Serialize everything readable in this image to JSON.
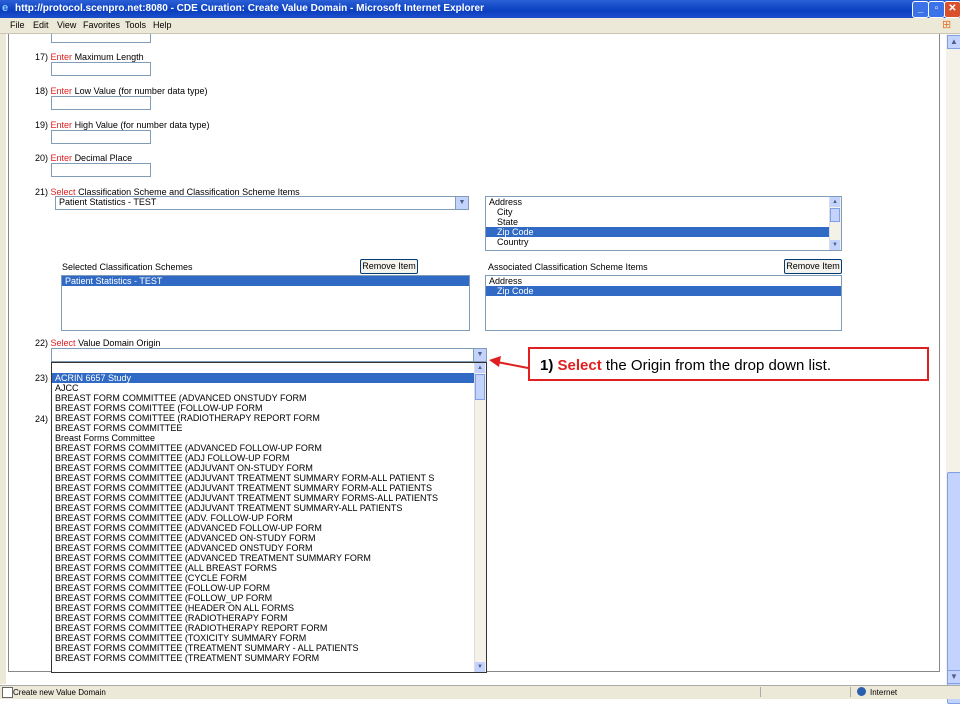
{
  "window": {
    "title": "http://protocol.scenpro.net:8080 - CDE Curation: Create Value Domain - Microsoft Internet Explorer",
    "menu": [
      "File",
      "Edit",
      "View",
      "Favorites",
      "Tools",
      "Help"
    ]
  },
  "form": {
    "enter_word": "Enter",
    "select_word": "Select",
    "item17": {
      "num": "17)",
      "text": "Maximum Length"
    },
    "item18": {
      "num": "18)",
      "text": "Low Value (for number data type)"
    },
    "item19": {
      "num": "19)",
      "text": "High Value (for number data type)"
    },
    "item20": {
      "num": "20)",
      "text": "Decimal Place"
    },
    "item21": {
      "num": "21)",
      "text": "Classification Scheme and Classification Scheme Items",
      "scheme_value": "Patient Statistics - TEST",
      "items_list": [
        {
          "label": "Address",
          "indent": false,
          "selected": false
        },
        {
          "label": "City",
          "indent": true,
          "selected": false
        },
        {
          "label": "State",
          "indent": true,
          "selected": false
        },
        {
          "label": "Zip Code",
          "indent": true,
          "selected": true
        },
        {
          "label": "Country",
          "indent": true,
          "selected": false
        }
      ],
      "selected_schemes_label": "Selected Classification Schemes",
      "selected_schemes": [
        "Patient Statistics - TEST"
      ],
      "associated_items_label": "Associated Classification Scheme Items",
      "associated_items": [
        {
          "label": "Address",
          "indent": false,
          "selected": false
        },
        {
          "label": "Zip Code",
          "indent": true,
          "selected": true
        }
      ],
      "remove_button": "Remove Item"
    },
    "item22": {
      "num": "22)",
      "text": "Value Domain Origin",
      "options": [
        "ACRIN 6657 Study",
        "AJCC",
        "BREAST FORM COMMITTEE (ADVANCED ONSTUDY FORM",
        "BREAST FORMS COMITTEE (FOLLOW-UP FORM",
        "BREAST FORMS COMITTEE (RADIOTHERAPY REPORT FORM",
        "BREAST FORMS COMMITTEE",
        "Breast Forms Committee",
        "BREAST FORMS COMMITTEE (ADVANCED FOLLOW-UP FORM",
        "BREAST FORMS COMMITTEE (ADJ FOLLOW-UP FORM",
        "BREAST FORMS COMMITTEE (ADJUVANT ON-STUDY FORM",
        "BREAST FORMS COMMITTEE (ADJUVANT TREATMENT SUMMARY FORM-ALL PATIENT S",
        "BREAST FORMS COMMITTEE (ADJUVANT TREATMENT SUMMARY FORM-ALL PATIENTS",
        "BREAST FORMS COMMITTEE (ADJUVANT TREATMENT SUMMARY FORMS-ALL PATIENTS",
        "BREAST FORMS COMMITTEE (ADJUVANT TREATMENT SUMMARY-ALL PATIENTS",
        "BREAST FORMS COMMITTEE (ADV. FOLLOW-UP FORM",
        "BREAST FORMS COMMITTEE (ADVANCED FOLLOW-UP FORM",
        "BREAST FORMS COMMITTEE (ADVANCED ON-STUDY FORM",
        "BREAST FORMS COMMITTEE (ADVANCED ONSTUDY FORM",
        "BREAST FORMS COMMITTEE (ADVANCED TREATMENT SUMMARY FORM",
        "BREAST FORMS COMMITTEE (ALL BREAST FORMS",
        "BREAST FORMS COMMITTEE (CYCLE FORM",
        "BREAST FORMS COMMITTEE (FOLLOW-UP FORM",
        "BREAST FORMS COMMITTEE (FOLLOW_UP FORM",
        "BREAST FORMS COMMITTEE (HEADER ON ALL FORMS",
        "BREAST FORMS COMMITTEE (RADIOTHERAPY FORM",
        "BREAST FORMS COMMITTEE (RADIOTHERAPY REPORT FORM",
        "BREAST FORMS COMMITTEE (TOXICITY SUMMARY FORM",
        "BREAST FORMS COMMITTEE (TREATMENT SUMMARY - ALL PATIENTS",
        "BREAST FORMS COMMITTEE (TREATMENT SUMMARY FORM"
      ]
    },
    "item23": {
      "num": "23)"
    },
    "item24": {
      "num": "24)"
    }
  },
  "callout": {
    "num": "1)",
    "highlight": "Select",
    "rest": "the Origin from the drop down list."
  },
  "status": {
    "text": "Create new Value Domain",
    "zone": "Internet"
  },
  "colors": {
    "accent_red": "#e02020",
    "selection_blue": "#316ac5"
  }
}
